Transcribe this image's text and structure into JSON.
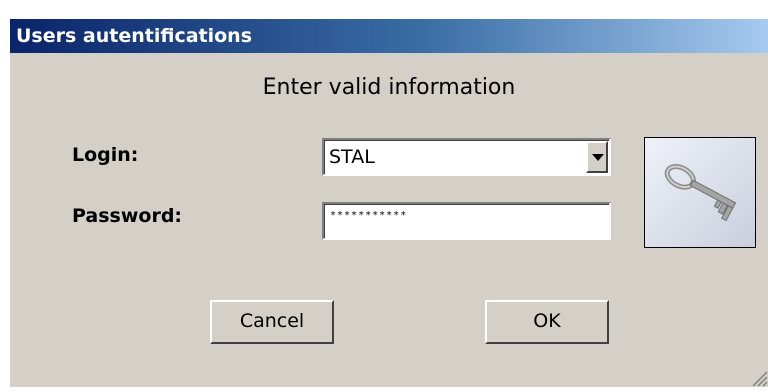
{
  "window": {
    "title": "Users autentifications"
  },
  "form": {
    "heading": "Enter valid information",
    "login_label": "Login:",
    "login_value": "STAL",
    "password_label": "Password:",
    "password_value": "***********"
  },
  "buttons": {
    "cancel_label": "Cancel",
    "ok_label": "OK"
  },
  "icons": {
    "dropdown": "chevron-down-icon",
    "image": "key-icon",
    "resize": "resize-grip-icon"
  },
  "colors": {
    "titlebar_start": "#0a246a",
    "titlebar_end": "#a6caf0",
    "face": "#d4d0c8"
  }
}
